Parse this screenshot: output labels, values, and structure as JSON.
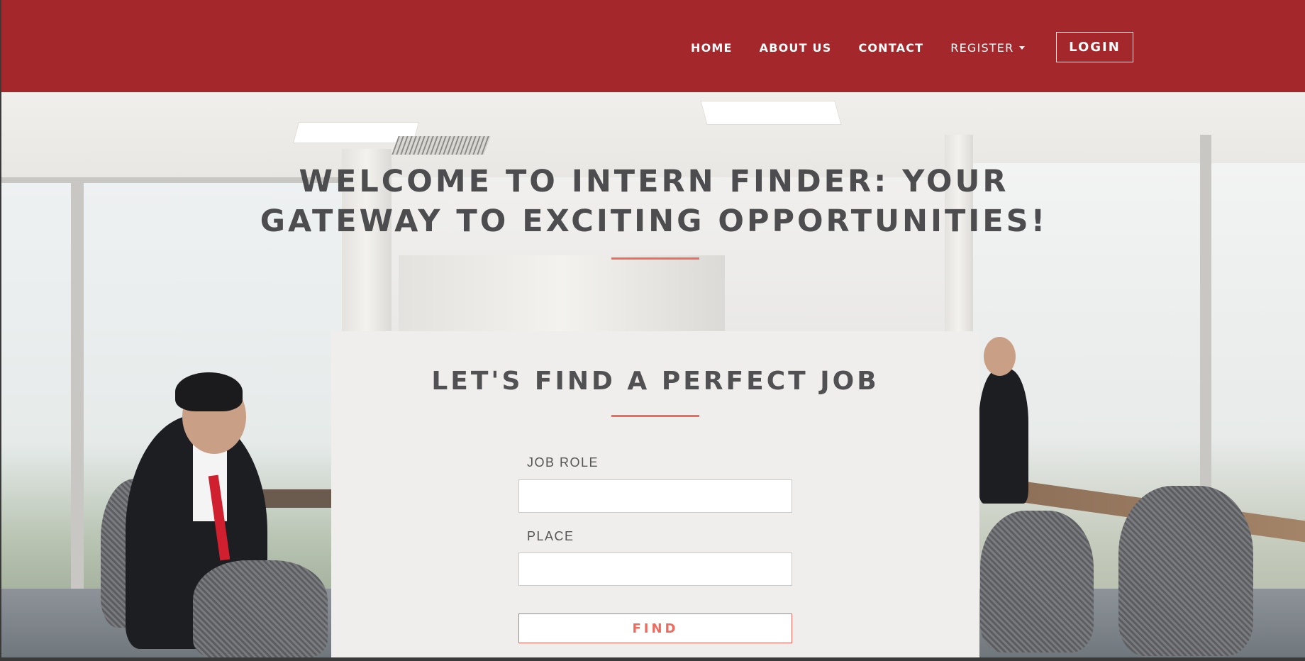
{
  "nav": {
    "links": [
      {
        "label": "HOME"
      },
      {
        "label": "ABOUT US"
      },
      {
        "label": "CONTACT"
      },
      {
        "label": "REGISTER"
      }
    ],
    "login_label": "LOGIN"
  },
  "hero": {
    "title_line1": "WELCOME TO INTERN FINDER: YOUR",
    "title_line2": "GATEWAY TO EXCITING OPPORTUNITIES!"
  },
  "search": {
    "title": "LET'S FIND A PERFECT JOB",
    "job_role_label": "JOB ROLE",
    "job_role_value": "",
    "place_label": "PLACE",
    "place_value": "",
    "find_label": "FIND"
  },
  "colors": {
    "navbar": "#a4282b",
    "accent": "#f06b5d",
    "card_bg": "#f0eeed",
    "title_text": "#4d4d4f"
  },
  "icons": {
    "register_dropdown": "caret-down-icon"
  }
}
